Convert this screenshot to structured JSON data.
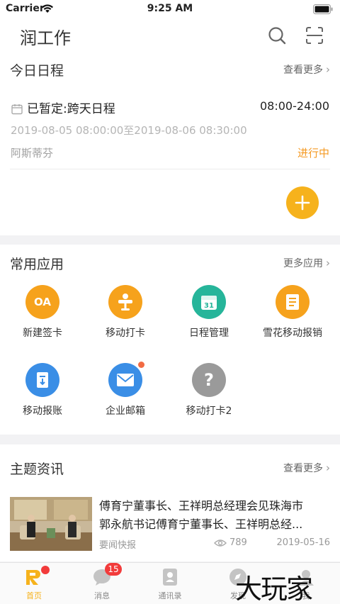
{
  "status_bar": {
    "carrier": "Carrier",
    "time": "9:25 AM"
  },
  "header": {
    "title": "润工作",
    "icons": [
      "search-icon",
      "scan-icon"
    ]
  },
  "schedule": {
    "section_title": "今日日程",
    "more_label": "查看更多",
    "item": {
      "title": "已暂定:跨天日程",
      "time": "08:00-24:00",
      "range": "2019-08-05 08:00:00至2019-08-06 08:30:00",
      "owner": "阿斯蒂芬",
      "status": "进行中"
    },
    "colors": {
      "status": "#f59a23",
      "fab": "#f6b21c"
    }
  },
  "apps": {
    "section_title": "常用应用",
    "more_label": "更多应用",
    "items": [
      {
        "label": "新建签卡",
        "icon": "oa-signin-icon",
        "color": "#f6a21c",
        "icon_text": "OA"
      },
      {
        "label": "移动打卡",
        "icon": "clock-in-icon",
        "color": "#f6a21c"
      },
      {
        "label": "日程管理",
        "icon": "calendar-icon",
        "color": "#26b59a",
        "icon_text": "31"
      },
      {
        "label": "雪花移动报销",
        "icon": "reimburse-icon",
        "color": "#f6a21c"
      },
      {
        "label": "移动报账",
        "icon": "report-icon",
        "color": "#3a8ee6"
      },
      {
        "label": "企业邮箱",
        "icon": "mail-icon",
        "color": "#3a8ee6",
        "has_dot": true
      },
      {
        "label": "移动打卡2",
        "icon": "help-icon",
        "color": "#9a9a9a",
        "icon_text": "?"
      }
    ]
  },
  "news": {
    "section_title": "主题资讯",
    "more_label": "查看更多",
    "item": {
      "title_line1": "傅育宁董事长、王祥明总经理会见珠海市",
      "title_line2": "郭永航书记傅育宁董事长、王祥明总经...",
      "source": "要闻快报",
      "views": "789",
      "date": "2019-05-16"
    }
  },
  "tabbar": {
    "tabs": [
      {
        "label": "首页",
        "icon": "home-icon",
        "active": true
      },
      {
        "label": "消息",
        "icon": "message-icon",
        "badge": "15"
      },
      {
        "label": "通讯录",
        "icon": "contacts-icon"
      },
      {
        "label": "发现",
        "icon": "discover-icon"
      },
      {
        "label": "我",
        "icon": "profile-icon"
      }
    ],
    "accent": "#f6b21c"
  },
  "watermark": "大玩家"
}
